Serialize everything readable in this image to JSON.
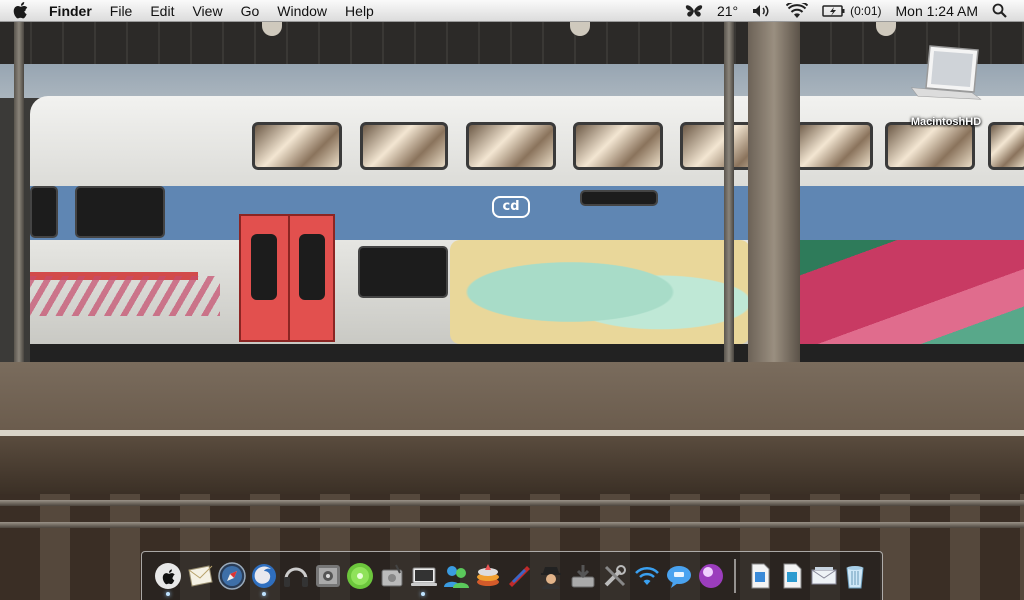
{
  "menubar": {
    "apple_icon": "apple-icon",
    "menus": [
      "Finder",
      "File",
      "Edit",
      "View",
      "Go",
      "Window",
      "Help"
    ],
    "status": {
      "weather_icon": "butterfly-weather-icon",
      "temperature": "21°",
      "volume_icon": "speaker-icon",
      "wifi_icon": "wifi-icon",
      "battery_icon": "battery-charging-icon",
      "battery_time": "(0:01)",
      "clock": "Mon 1:24 AM",
      "spotlight_icon": "magnifier-icon"
    }
  },
  "desktop": {
    "icons": [
      {
        "label": "MacintoshHD",
        "icon": "laptop-drive-icon"
      }
    ]
  },
  "dock": {
    "items": [
      {
        "icon": "finder-apple-icon",
        "running": true
      },
      {
        "icon": "mail-icon",
        "running": false
      },
      {
        "icon": "safari-compass-icon",
        "running": false
      },
      {
        "icon": "firefox-globe-icon",
        "running": true
      },
      {
        "icon": "itunes-headphones-icon",
        "running": false
      },
      {
        "icon": "system-preferences-icon",
        "running": false
      },
      {
        "icon": "green-disc-icon",
        "running": false
      },
      {
        "icon": "disk-utility-icon",
        "running": false
      },
      {
        "icon": "laptop-screen-icon",
        "running": true
      },
      {
        "icon": "messenger-people-icon",
        "running": false
      },
      {
        "icon": "layers-stack-icon",
        "running": false
      },
      {
        "icon": "candy-bar-icon",
        "running": false
      },
      {
        "icon": "spy-agent-icon",
        "running": false
      },
      {
        "icon": "drive-download-icon",
        "running": false
      },
      {
        "icon": "utilities-tools-icon",
        "running": false
      },
      {
        "icon": "wifi-icon",
        "running": false
      },
      {
        "icon": "chat-bubble-icon",
        "running": false
      },
      {
        "icon": "purple-ball-icon",
        "running": false
      },
      {
        "separator": true
      },
      {
        "icon": "document-icon",
        "running": false
      },
      {
        "icon": "document-alt-icon",
        "running": false
      },
      {
        "icon": "envelope-stack-icon",
        "running": false
      },
      {
        "icon": "trash-icon",
        "running": false
      }
    ]
  }
}
